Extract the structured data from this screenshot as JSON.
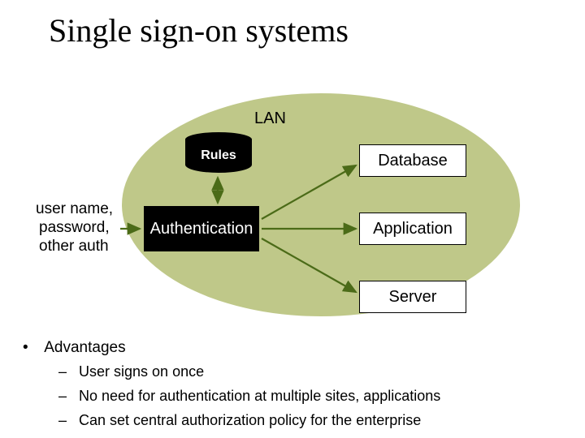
{
  "title": "Single sign-on systems",
  "diagram": {
    "lan_label": "LAN",
    "rules_label": "Rules",
    "auth_label": "Authentication",
    "user_label_l1": "user name,",
    "user_label_l2": "password,",
    "user_label_l3": "other auth",
    "database_label": "Database",
    "application_label": "Application",
    "server_label": "Server"
  },
  "bullets": {
    "heading": "Advantages",
    "items": [
      "User signs on once",
      "No need for authentication at multiple sites, applications",
      "Can set central authorization policy for the enterprise"
    ]
  },
  "colors": {
    "ellipse_fill": "#bfc889",
    "arrow_green": "#4b6b18"
  }
}
